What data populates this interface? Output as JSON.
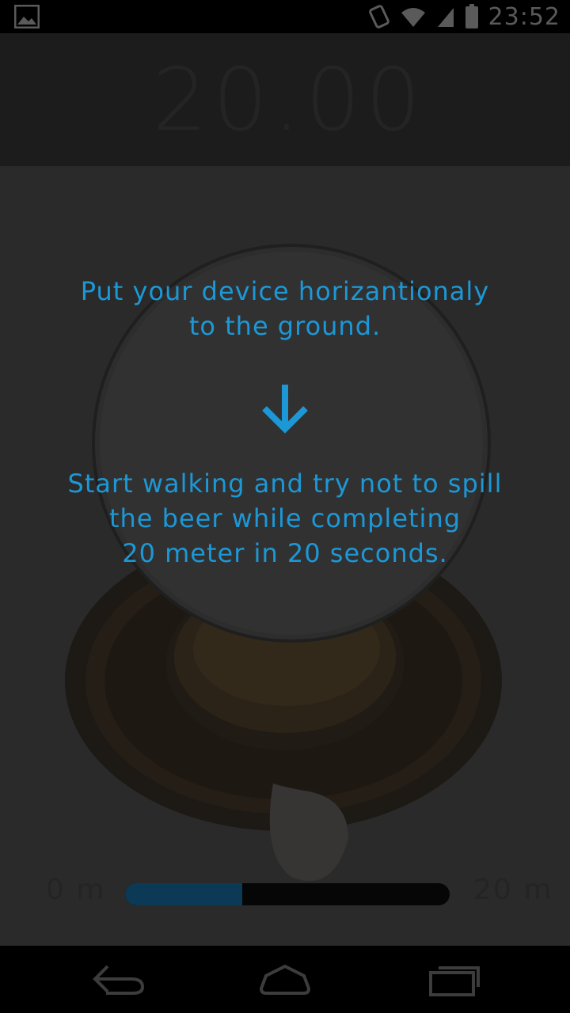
{
  "status_bar": {
    "time": "23:52",
    "icons": [
      "gallery-icon",
      "rotate-icon",
      "wifi-icon",
      "signal-icon",
      "battery-icon"
    ]
  },
  "timer": {
    "value": "20.00"
  },
  "instructions": {
    "line1": "Put your device horizantionaly",
    "line2": "to the ground.",
    "arrow_icon": "arrow-down-icon",
    "line3": "Start walking and try not to spill",
    "line4": "the beer while completing",
    "line5": "20 meter in 20 seconds."
  },
  "progress": {
    "start_label": "0 m",
    "end_label": "20 m",
    "fraction": 0.36
  },
  "nav_bar": {
    "buttons": [
      "back-icon",
      "home-icon",
      "recent-apps-icon"
    ]
  },
  "colors": {
    "accent": "#1c98d6",
    "overlay_dim": "#2a2a2a",
    "progress_fill": "#0c3a56"
  }
}
